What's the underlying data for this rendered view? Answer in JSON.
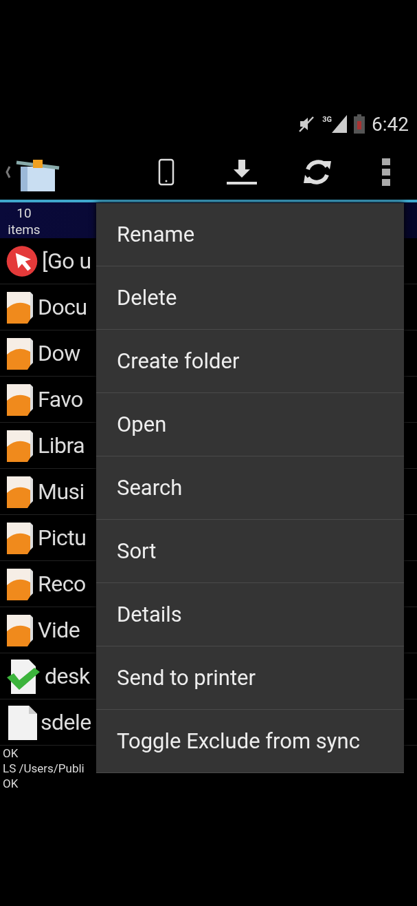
{
  "status_bar": {
    "time": "6:42",
    "network": "3G"
  },
  "list_header": {
    "count": "10",
    "unit": "items"
  },
  "rows": [
    {
      "kind": "up",
      "name": "[Go u"
    },
    {
      "kind": "folder",
      "name": "Docu"
    },
    {
      "kind": "folder",
      "name": "Dow"
    },
    {
      "kind": "folder",
      "name": "Favo"
    },
    {
      "kind": "folder",
      "name": "Libra"
    },
    {
      "kind": "folder",
      "name": "Musi"
    },
    {
      "kind": "folder",
      "name": "Pictu"
    },
    {
      "kind": "folder",
      "name": "Reco"
    },
    {
      "kind": "folder",
      "name": "Vide"
    },
    {
      "kind": "checked-file",
      "name": "desk"
    },
    {
      "kind": "file",
      "name": "sdele"
    }
  ],
  "log": [
    "OK",
    "LS /Users/Publi",
    "OK"
  ],
  "context_menu": [
    "Rename",
    "Delete",
    "Create folder",
    "Open",
    "Search",
    "Sort",
    "Details",
    "Send to printer",
    "Toggle Exclude from sync"
  ]
}
